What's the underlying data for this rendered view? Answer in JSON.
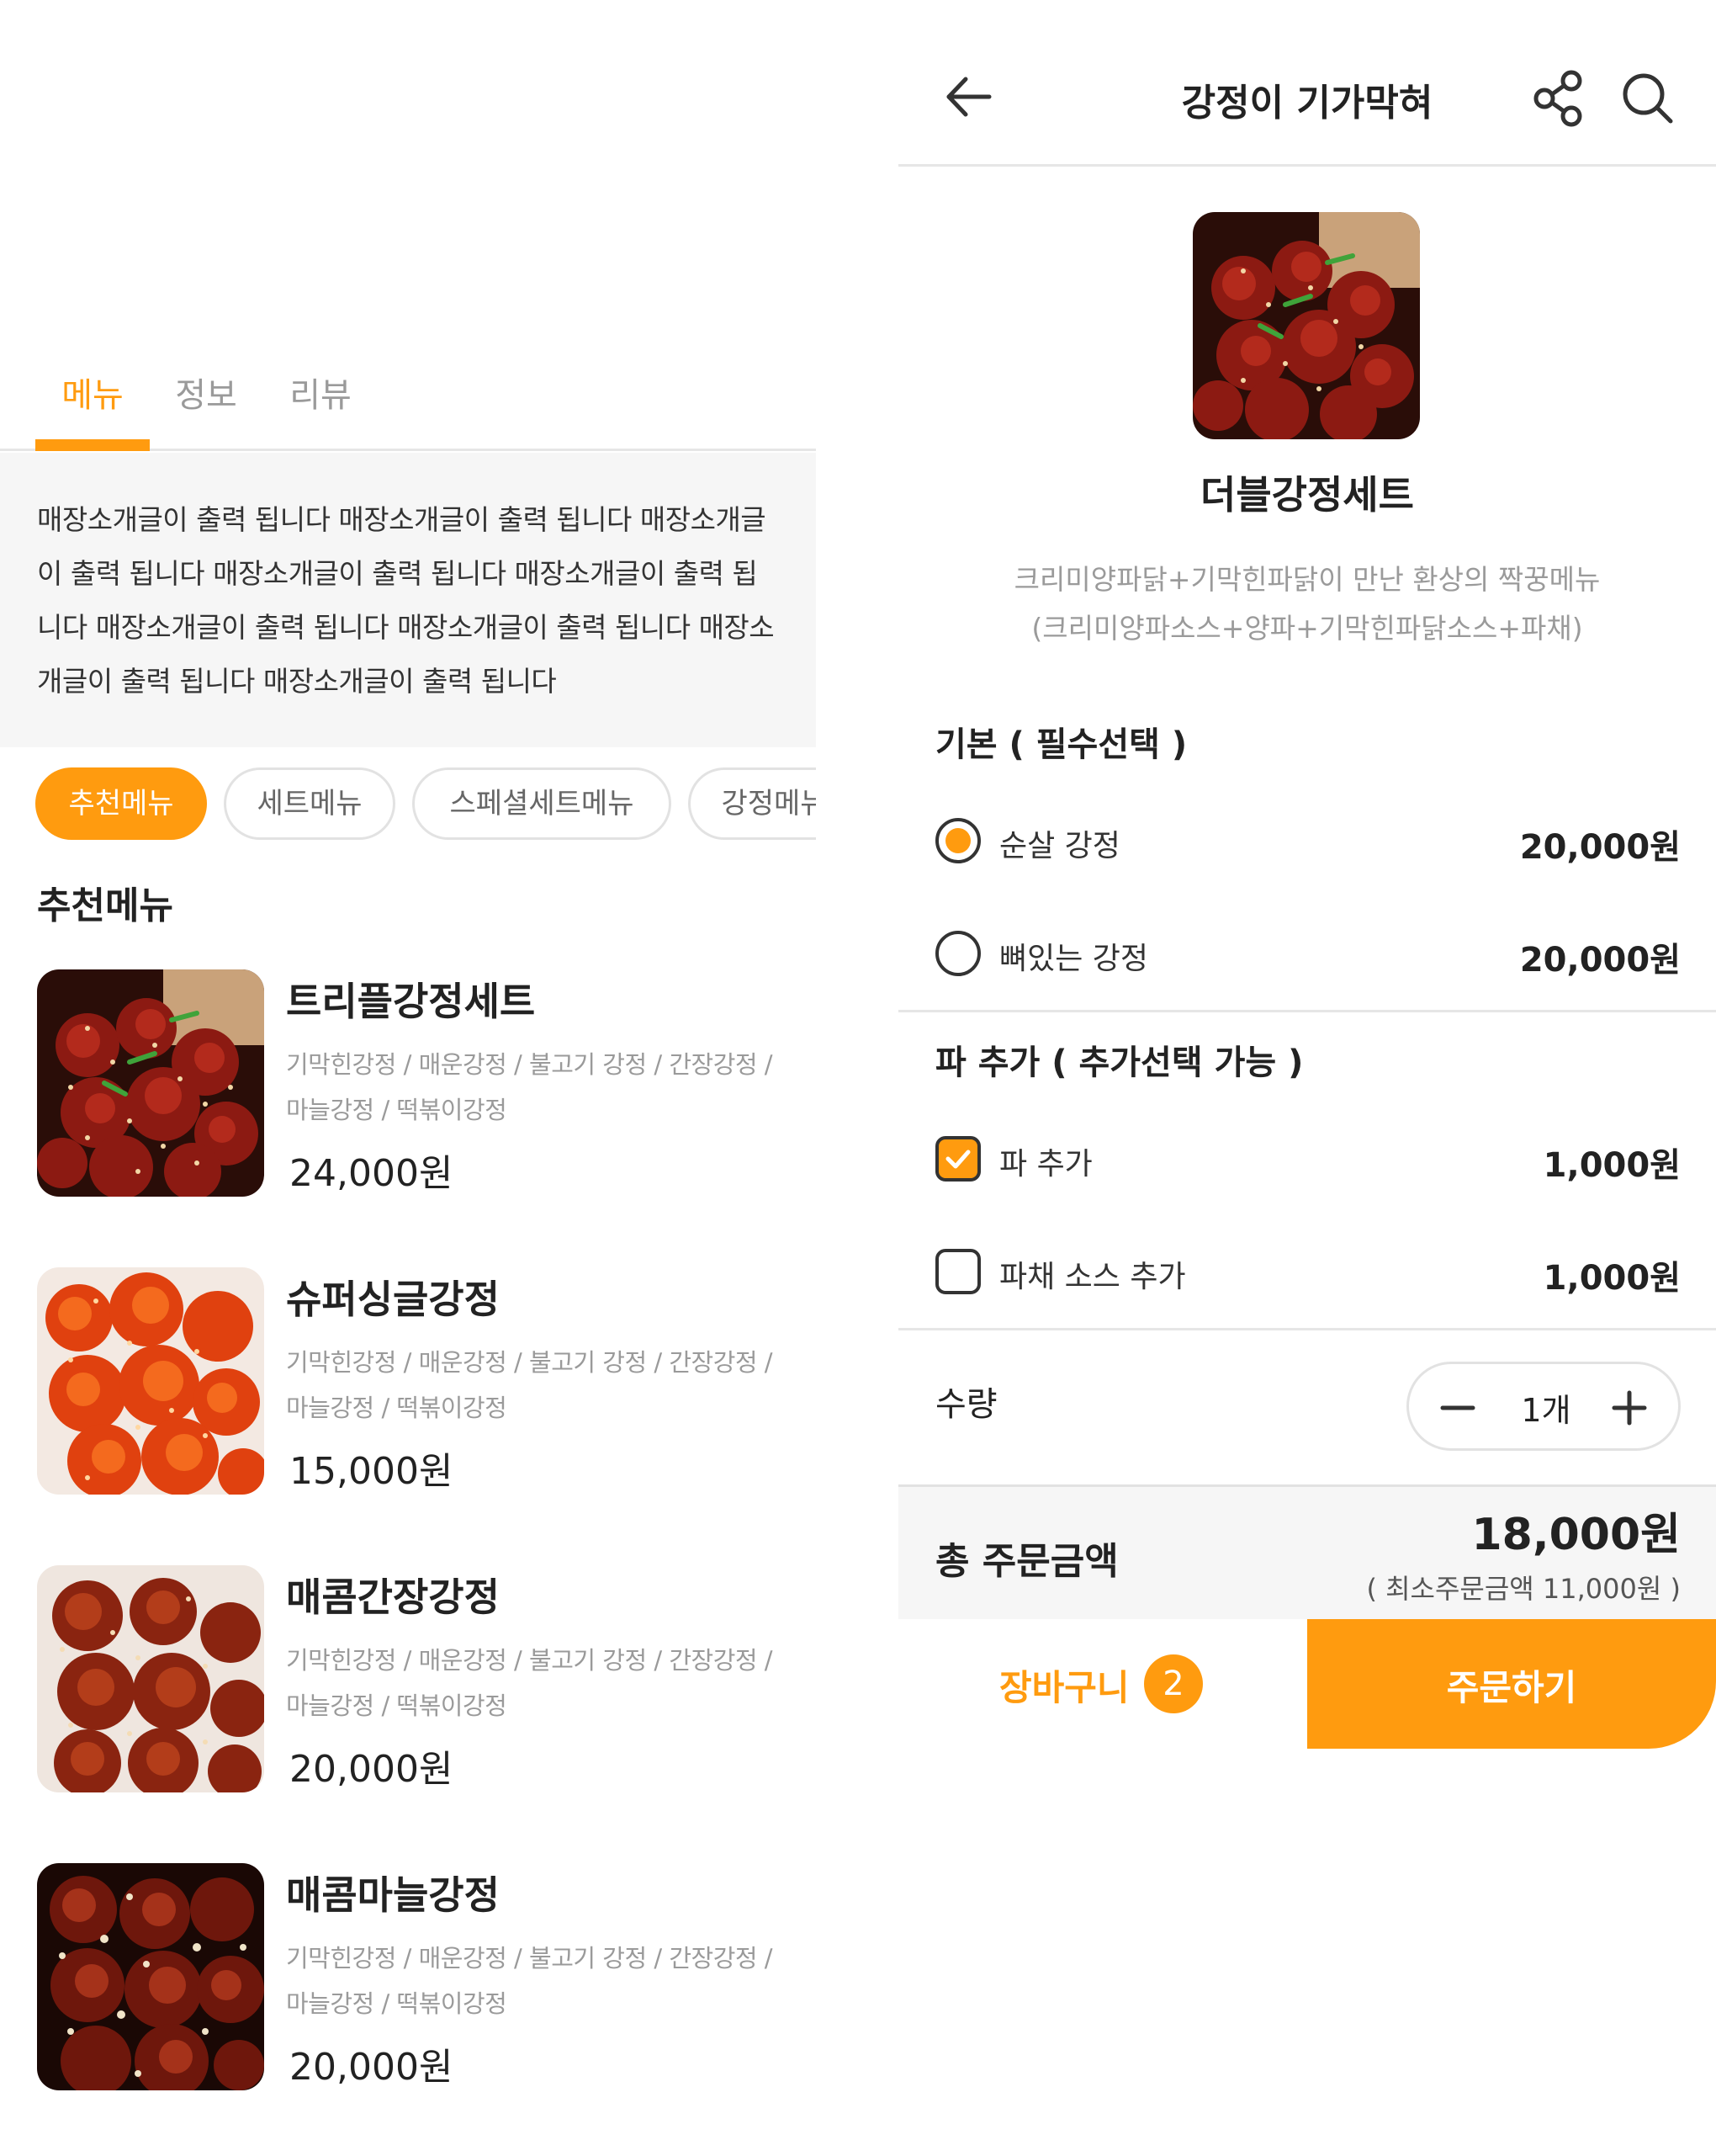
{
  "colors": {
    "accent": "#ff9b0f",
    "divider": "#e6e6e6",
    "muted": "#9a9a9a"
  },
  "left": {
    "tabs": [
      {
        "label": "메뉴",
        "active": true
      },
      {
        "label": "정보",
        "active": false
      },
      {
        "label": "리뷰",
        "active": false
      }
    ],
    "intro": "매장소개글이 출력 됩니다 매장소개글이 출력 됩니다 매장소개글이 출력 됩니다 매장소개글이 출력 됩니다 매장소개글이 출력 됩니다 매장소개글이 출력 됩니다 매장소개글이 출력 됩니다 매장소개글이 출력 됩니다 매장소개글이 출력 됩니다",
    "categories": [
      {
        "label": "추천메뉴",
        "active": true
      },
      {
        "label": "세트메뉴",
        "active": false
      },
      {
        "label": "스페셜세트메뉴",
        "active": false
      },
      {
        "label": "강정메뉴",
        "active": false
      }
    ],
    "section_title": "추천메뉴",
    "items": [
      {
        "name": "트리플강정세트",
        "desc": "기막힌강정 / 매운강정 / 불고기 강정 / 간장강정 / 마늘강정 / 떡볶이강정",
        "price": "24,000원"
      },
      {
        "name": "슈퍼싱글강정",
        "desc": "기막힌강정 / 매운강정 / 불고기 강정 / 간장강정 / 마늘강정 / 떡볶이강정",
        "price": "15,000원"
      },
      {
        "name": "매콤간장강정",
        "desc": "기막힌강정 / 매운강정 / 불고기 강정 / 간장강정 / 마늘강정 / 떡볶이강정",
        "price": "20,000원"
      },
      {
        "name": "매콤마늘강정",
        "desc": "기막힌강정 / 매운강정 / 불고기 강정 / 간장강정 / 마늘강정 / 떡볶이강정",
        "price": "20,000원"
      }
    ]
  },
  "right": {
    "store_title": "강정이 기가막혀",
    "icons": {
      "back": "arrow-left-icon",
      "share": "share-icon",
      "search": "search-icon"
    },
    "product": {
      "name": "더블강정세트",
      "desc_line1": "크리미양파닭+기막힌파닭이 만난 환상의 짝꿍메뉴",
      "desc_line2": "(크리미양파소스+양파+기막힌파닭소스+파채)"
    },
    "base_group": {
      "title": "기본 ( 필수선택 )",
      "options": [
        {
          "label": "순살 강정",
          "price": "20,000원",
          "selected": true
        },
        {
          "label": "뼈있는 강정",
          "price": "20,000원",
          "selected": false
        }
      ]
    },
    "extra_group": {
      "title": "파 추가 ( 추가선택 가능 )",
      "options": [
        {
          "label": "파 추가",
          "price": "1,000원",
          "checked": true
        },
        {
          "label": "파채 소스 추가",
          "price": "1,000원",
          "checked": false
        }
      ]
    },
    "quantity": {
      "label": "수량",
      "value": "1개"
    },
    "total": {
      "label": "총 주문금액",
      "price": "18,000원",
      "min_order": "( 최소주문금액 11,000원 )"
    },
    "cart": {
      "label": "장바구니",
      "count": "2"
    },
    "order": {
      "label": "주문하기"
    }
  }
}
